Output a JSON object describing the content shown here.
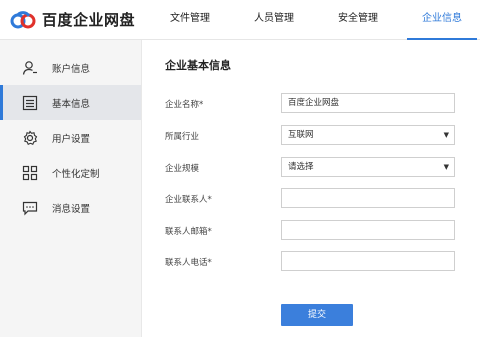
{
  "app": {
    "logo_text": "百度企业网盘",
    "brand_colors": {
      "blue": "#2f7ad9",
      "red": "#e0312b"
    }
  },
  "nav": {
    "tabs": [
      {
        "label": "文件管理",
        "active": false
      },
      {
        "label": "人员管理",
        "active": false
      },
      {
        "label": "安全管理",
        "active": false
      },
      {
        "label": "企业信息",
        "active": true
      }
    ]
  },
  "sidebar": {
    "items": [
      {
        "label": "账户信息",
        "icon": "user-icon",
        "active": false
      },
      {
        "label": "基本信息",
        "icon": "document-list-icon",
        "active": true
      },
      {
        "label": "用户设置",
        "icon": "gear-icon",
        "active": false
      },
      {
        "label": "个性化定制",
        "icon": "grid-icon",
        "active": false
      },
      {
        "label": "消息设置",
        "icon": "message-icon",
        "active": false
      }
    ]
  },
  "main": {
    "title": "企业基本信息",
    "fields": [
      {
        "label": "企业名称",
        "required": "*",
        "type": "input",
        "value": "百度企业网盘"
      },
      {
        "label": "所属行业",
        "required": "",
        "type": "select",
        "value": "互联网"
      },
      {
        "label": "企业规模",
        "required": "",
        "type": "select",
        "value": "请选择"
      },
      {
        "label": "企业联系人",
        "required": "*",
        "type": "input",
        "value": ""
      },
      {
        "label": "联系人邮箱",
        "required": "*",
        "type": "input",
        "value": ""
      },
      {
        "label": "联系人电话",
        "required": "*",
        "type": "input",
        "value": ""
      }
    ],
    "select_arrow": "▼",
    "submit_label": "提交"
  }
}
